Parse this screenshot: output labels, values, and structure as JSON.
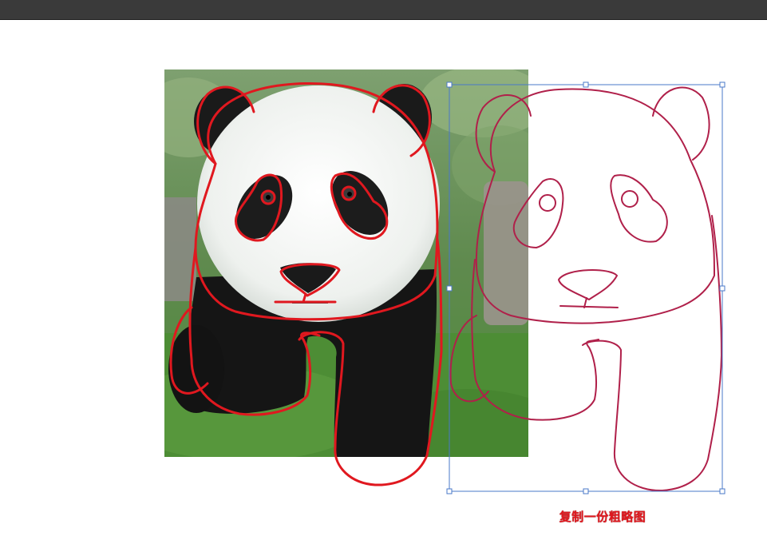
{
  "caption": "复制一份粗略图",
  "colors": {
    "trace_stroke": "#e0181f",
    "copy_stroke": "#b0204a",
    "selection_box": "#4a78c8",
    "top_bar": "#3a3a3a"
  },
  "icons": [
    "selection-handle-icon"
  ]
}
